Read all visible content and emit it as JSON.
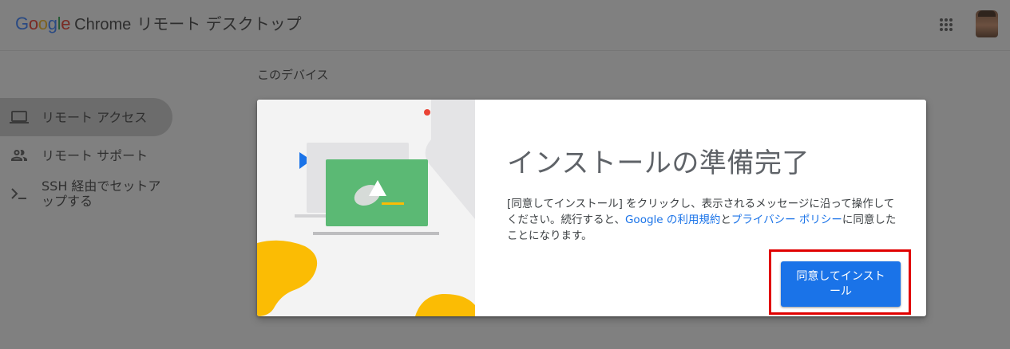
{
  "header": {
    "brand_letters": [
      "G",
      "o",
      "o",
      "g",
      "l",
      "e"
    ],
    "chrome": "Chrome",
    "product": "リモート デスクトップ",
    "apps_icon": "google-apps-grid-icon",
    "avatar_icon": "account-avatar"
  },
  "sidebar": {
    "items": [
      {
        "label": "リモート アクセス",
        "icon": "laptop-icon",
        "active": true
      },
      {
        "label": "リモート サポート",
        "icon": "people-icon",
        "active": false
      },
      {
        "label": "SSH 経由でセットアップする",
        "icon": "terminal-prompt-icon",
        "active": false
      }
    ]
  },
  "main": {
    "section_title": "このデバイス"
  },
  "dialog": {
    "title": "インストールの準備完了",
    "body_pre": "[同意してインストール] をクリックし、表示されるメッセージに沿って操作してください。続行すると、",
    "terms_link": "Google の利用規約",
    "body_mid": "と",
    "privacy_link": "プライバシー ポリシー",
    "body_post": "に同意したことになります。",
    "install_button": "同意してインストール",
    "colors": {
      "accent": "#1a73e8",
      "highlight_border": "#e00000",
      "illustration_green": "#34a853",
      "illustration_yellow": "#fbbc04",
      "illustration_red": "#ea4335"
    }
  }
}
